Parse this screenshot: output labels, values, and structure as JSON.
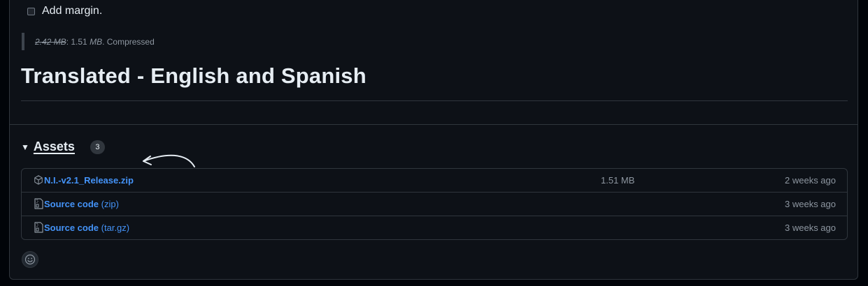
{
  "form": {
    "add_margin_label": "Add margin.",
    "add_margin_checked": false
  },
  "compression_note": {
    "original_size": "2.42 MB",
    "compressed_size": "1.51",
    "compressed_unit": "MB",
    "status": ". Compressed"
  },
  "release": {
    "title": "Translated - English and Spanish"
  },
  "assets": {
    "label": "Assets",
    "count": "3",
    "items": [
      {
        "icon": "package-icon",
        "name": "N.I.-v2.1_Release.zip",
        "suffix": "",
        "size": "1.51 MB",
        "date": "2 weeks ago"
      },
      {
        "icon": "file-zip-icon",
        "name": "Source code",
        "suffix": "(zip)",
        "size": "",
        "date": "3 weeks ago"
      },
      {
        "icon": "file-zip-icon",
        "name": "Source code",
        "suffix": "(tar.gz)",
        "size": "",
        "date": "3 weeks ago"
      }
    ]
  },
  "colors": {
    "background": "#0d1117",
    "border": "#30363d",
    "link": "#4493f8",
    "muted": "#8d96a0",
    "text": "#e6edf3"
  }
}
